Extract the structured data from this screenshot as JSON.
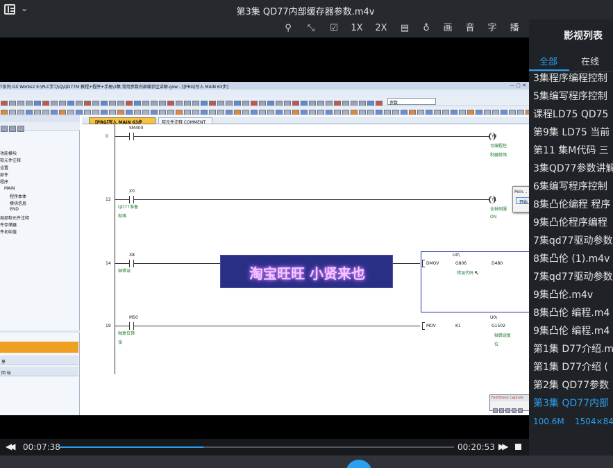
{
  "window": {
    "title": "第3集  QD77内部缓存器参数.m4v"
  },
  "toolbar": {
    "items": [
      {
        "icon": "pin-icon",
        "glyph": "⚲"
      },
      {
        "icon": "fullscreen-icon",
        "glyph": "⤡"
      },
      {
        "icon": "edit-icon",
        "glyph": "☑"
      },
      {
        "label": "1X"
      },
      {
        "label": "2X"
      },
      {
        "icon": "subtitle-box-icon",
        "glyph": "▤"
      },
      {
        "icon": "bulb-icon",
        "glyph": "♁"
      },
      {
        "label": "画"
      },
      {
        "label": "音"
      },
      {
        "label": "字"
      },
      {
        "label": "播"
      }
    ]
  },
  "sidebar": {
    "title": "影视列表",
    "tabs": [
      {
        "label": "全部",
        "active": true
      },
      {
        "label": "在线",
        "active": false
      }
    ],
    "items": [
      "3集程序编程控制",
      "5集编写程序控制",
      "课程LD75 QD75",
      "第9集 LD75 当前",
      "第11 集M代码 三",
      "3集QD77参数讲解",
      "6集编写程序控制",
      "8集凸伦编程 程序",
      "9集凸伦程序编程",
      "7集qd77驱动参数",
      "8集凸伦 (1).m4v",
      "7集qd77驱动参数",
      "9集凸伦.m4v",
      "8集凸伦 编程.m4",
      "9集凸伦 编程.m4",
      "第1集  D77介绍.m",
      "第1集  D77介绍 (",
      "第2集  QD77参数",
      "第3集  QD77内部"
    ],
    "active_index": 18,
    "active_meta": {
      "size": "100.6M",
      "resolution": "1504×844"
    }
  },
  "player": {
    "current_time": "00:07:38",
    "total_time": "00:20:53",
    "progress": 0.365
  },
  "overlay": {
    "watermark": "淘宝旺旺  小贤来也"
  },
  "gxworks": {
    "title": "T系列 GX Works2 E:\\PLC学习\\Q\\QD77M 教程+程序+手册\\3集 常用参数内部缓存区讲解.gxw - [[PRG]写入 MAIN 63步]",
    "menu": [
      "编辑(E)",
      "搜索/替换(F)",
      "转换/编译(C)",
      "视图(V)",
      "在线(O)",
      "调试(B)",
      "诊断(D)",
      "工具(T)",
      "窗口(W)",
      "帮助(H)"
    ],
    "param_box": "参数",
    "tabs": [
      "[PRG]写入 MAIN 63步",
      "软元件注释 COMMENT"
    ],
    "tree": [
      "功能模块",
      "软元件注释",
      "设置",
      "部件",
      "程序",
      "MAIN",
      "程序本体",
      "模块信息",
      "END",
      "局部软元件注释",
      "件存储器",
      "件初始值"
    ],
    "panel_headers": [
      "享",
      "回 标"
    ],
    "popup": {
      "title": "Poin...",
      "button": "开始"
    },
    "faststone": "FastStone Capture",
    "rungs": [
      {
        "step": "0",
        "contact": "SM400",
        "coil": "Y0",
        "coil_comment": [
          "可编程控",
          "制器就绪"
        ]
      },
      {
        "step": "12",
        "contact": "X0",
        "contact_comment": [
          "QD77准备",
          "就绪"
        ],
        "coil": "Y1",
        "coil_comment": [
          "全轴伺服",
          "ON"
        ]
      },
      {
        "step": "14",
        "contact": "X8",
        "contact_comment": [
          "轴错误"
        ],
        "instr": "DMOV",
        "op1_prefix": "U0\\",
        "op1": "G806",
        "op1_comment": "错误代码",
        "op2": "D480"
      },
      {
        "step": "19",
        "contact": "M50",
        "contact_comment": [
          "轴复位错",
          "误"
        ],
        "instr": "MOV",
        "op1": "K1",
        "op2_prefix": "U0\\",
        "op2": "G1502",
        "op2_comment": [
          "轴错误复",
          "位"
        ]
      }
    ]
  },
  "colors": {
    "accent": "#2aa0f0",
    "panel": "#1f2226",
    "orange": "#f0a020",
    "watermark": "#d98cff"
  }
}
